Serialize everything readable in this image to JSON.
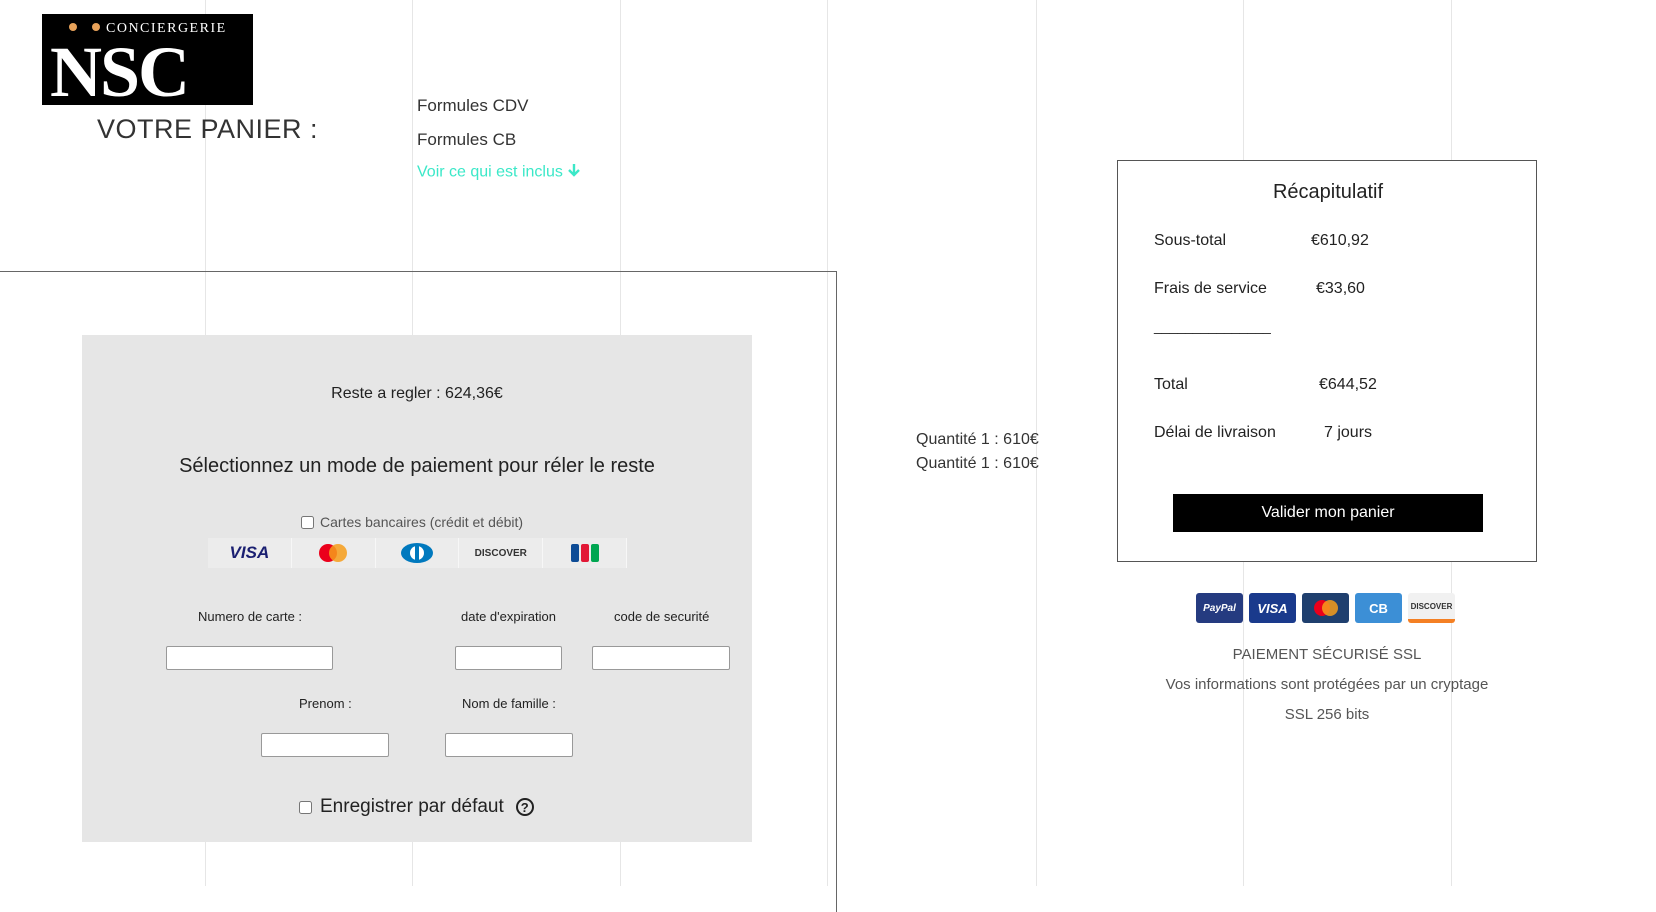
{
  "logo": {
    "top_text": "CONCIERGERIE",
    "main_text": "NSC"
  },
  "cart": {
    "title": "VOTRE PANIER :"
  },
  "formules": {
    "items": [
      "Formules CDV",
      "Formules CB"
    ],
    "see_included": "Voir ce qui est inclus"
  },
  "payment": {
    "rest_label": "Reste a regler : 624,36€",
    "select_title": "Sélectionnez un mode de paiement pour réler le reste",
    "card_option_label": "Cartes bancaires (crédit et débit)",
    "card_brands": [
      "VISA",
      "Mastercard",
      "Diners Club",
      "DISCOVER",
      "JCB"
    ],
    "fields": {
      "card_number_label": "Numero de carte :",
      "expiration_label": "date d'expiration",
      "security_label": "code de securité",
      "first_name_label": "Prenom :",
      "last_name_label": "Nom de famille :"
    },
    "save_default_label": "Enregistrer par défaut"
  },
  "quantities": [
    "Quantité 1 : 610€",
    "Quantité 1 : 610€"
  ],
  "summary": {
    "title": "Récapitulatif",
    "subtotal_label": "Sous-total",
    "subtotal_value": "€610,92",
    "service_label": "Frais de service",
    "service_value": "€33,60",
    "separator": "_______________",
    "total_label": "Total",
    "total_value": "€644,52",
    "delivery_label": "Délai de livraison",
    "delivery_value": "7 jours",
    "validate_label": "Valider mon panier"
  },
  "badges": [
    "PayPal",
    "VISA",
    "MasterCard",
    "CB",
    "DISCOVER"
  ],
  "ssl": {
    "title": "PAIEMENT SÉCURISÉ SSL",
    "line1": "Vos informations sont protégées par un cryptage",
    "line2": "SSL 256 bits"
  },
  "colors": {
    "accent": "#3be8c8",
    "panel": "#e6e6e6",
    "button": "#000000"
  }
}
